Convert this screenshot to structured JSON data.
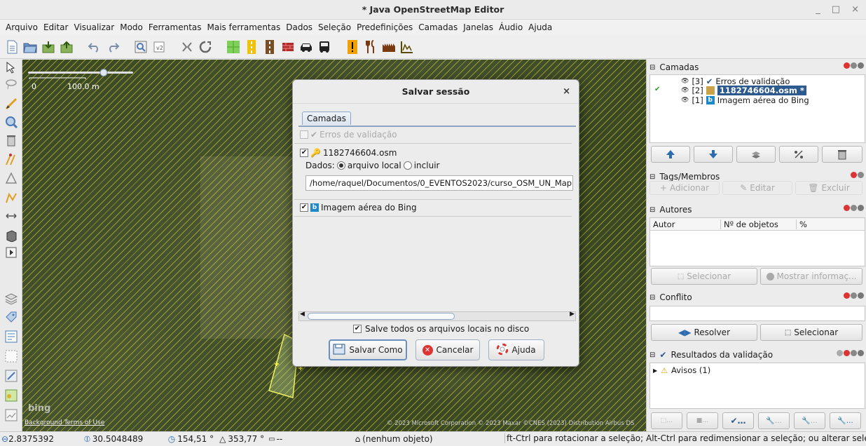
{
  "window": {
    "title": "* Java OpenStreetMap Editor",
    "controls": [
      "_",
      "□",
      "×"
    ]
  },
  "menu": [
    "Arquivo",
    "Editar",
    "Visualizar",
    "Modo",
    "Ferramentas",
    "Mais ferramentas",
    "Dados",
    "Seleção",
    "Predefinições",
    "Camadas",
    "Janelas",
    "Áudio",
    "Ajuda"
  ],
  "map": {
    "scale_start": "0",
    "scale_label": "100.0 m",
    "bing_logo": "bing",
    "terms": "Background Terms of Use",
    "attribution": "© 2023 Microsoft Corporation © 2023 Maxar ©CNES (2023) Distribution Airbus DS"
  },
  "dialog": {
    "title": "Salvar sessão",
    "close": "×",
    "tab": "Camadas",
    "layer_validation": "Erros de validação",
    "layer_osm": "1182746604.osm",
    "dados_label": "Dados:",
    "radio_local": "arquivo local",
    "radio_include": "incluir",
    "path": "/home/raquel/Documentos/0_EVENTOS2023/curso_OSM_UN_Mappe",
    "layer_bing": "Imagem aérea do Bing",
    "save_all": "Salve todos os arquivos locais no disco",
    "btn_save_as": "Salvar Como",
    "btn_cancel": "Cancelar",
    "btn_help": "Ajuda"
  },
  "panels": {
    "layers": {
      "title": "Camadas",
      "items": [
        {
          "index": "[3]",
          "name": "Erros de validação"
        },
        {
          "index": "[2]",
          "name": "1182746604.osm *"
        },
        {
          "index": "[1]",
          "name": "Imagem aérea do Bing"
        }
      ]
    },
    "tags": {
      "title": "Tags/Membros",
      "add": "Adicionar",
      "edit": "Editar",
      "delete": "Excluir"
    },
    "authors": {
      "title": "Autores",
      "col_author": "Autor",
      "col_count": "Nº de objetos",
      "col_pct": "%",
      "select": "Selecionar",
      "show_info": "Mostrar informaç..."
    },
    "conflict": {
      "title": "Conflito",
      "resolve": "Resolver",
      "select": "Selecionar"
    },
    "validation": {
      "title": "Resultados da validação",
      "warnings": "Avisos (1)"
    }
  },
  "status": {
    "lat": "2.8375392",
    "lon": "30.5048489",
    "heading": "154,51 °",
    "angle": "353,77 °",
    "distance": "--",
    "selection": "(nenhum objeto)",
    "hint": "ft-Ctrl para rotacionar a seleção; Alt-Ctrl para redimensionar a seleção; ou alterar seleção"
  },
  "colors": {
    "selected_row": "#2c5a8e",
    "hatch": "#e6dc3c",
    "dialog_accent": "#8ca5c4"
  }
}
